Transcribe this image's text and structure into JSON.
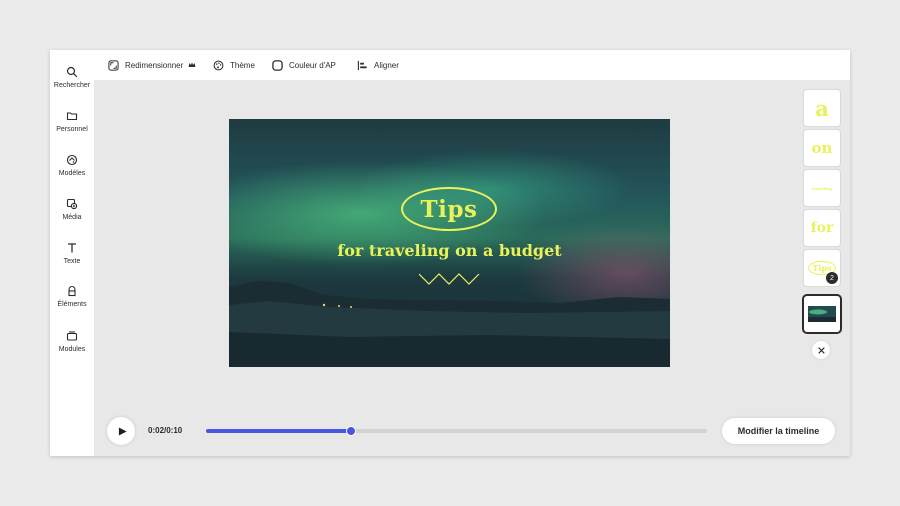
{
  "sidebar": {
    "items": [
      {
        "label": "Rechercher",
        "icon": "search-icon"
      },
      {
        "label": "Personnel",
        "icon": "folder-icon"
      },
      {
        "label": "Modèles",
        "icon": "templates-icon"
      },
      {
        "label": "Média",
        "icon": "media-icon"
      },
      {
        "label": "Texte",
        "icon": "text-icon"
      },
      {
        "label": "Éléments",
        "icon": "shapes-icon"
      },
      {
        "label": "Modules",
        "icon": "modules-icon"
      }
    ]
  },
  "toolbar": {
    "resize_label": "Redimensionner",
    "theme_label": "Thème",
    "color_label": "Couleur d'AP",
    "align_label": "Aligner"
  },
  "canvas": {
    "title": "Tips",
    "subtitle": "for traveling on a budget"
  },
  "layers": {
    "items": [
      {
        "text": "a"
      },
      {
        "text": "on"
      },
      {
        "text": "traveling"
      },
      {
        "text": "for"
      },
      {
        "text": "Tips",
        "badge": "2"
      }
    ],
    "selected": "background-image"
  },
  "playback": {
    "time": "0:02/0:10",
    "progress": 0.29,
    "timeline_button": "Modifier la timeline"
  },
  "colors": {
    "accent_yellow": "#eaf25a",
    "progress_blue": "#4a55e0"
  }
}
